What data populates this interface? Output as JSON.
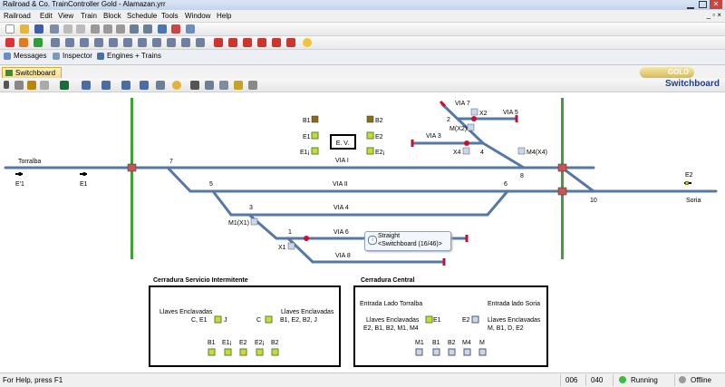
{
  "window": {
    "title": "Railroad & Co. TrainController Gold - Alamazan.yrr"
  },
  "menu": [
    "Railroad",
    "Edit",
    "View",
    "Train",
    "Block",
    "Schedule",
    "Tools",
    "Window",
    "Help"
  ],
  "panels": {
    "messages": "Messages",
    "inspector": "Inspector",
    "engines": "Engines + Trains"
  },
  "tab": {
    "label": "Switchboard"
  },
  "brand": {
    "badge": "GOLD"
  },
  "view_title": "Switchboard",
  "labels": {
    "torralba": "Torralba",
    "soria": "Soria",
    "via1": "VIA I",
    "via2": "VIA II",
    "via3": "VIA 3",
    "via4": "VIA 4",
    "via5": "VIA 5",
    "via6": "VIA 6",
    "via7": "VIA 7",
    "via8": "VIA 8",
    "ev": "E. V.",
    "b1": "B1",
    "b2": "B2",
    "e1": "E1",
    "e2": "E2",
    "e1j": "E1¡",
    "e2j": "E2¡",
    "e1_left": "E'1",
    "e1_left2": "E1",
    "e2_right": "E2",
    "n7": "7",
    "n5": "5",
    "n3": "3",
    "n1": "1",
    "n6": "6",
    "n10": "10",
    "n8": "8",
    "n2": "2",
    "n4": "4",
    "x2": "X2",
    "mx2": "M(X2)",
    "x4": "X4",
    "m4x4": "M4(X4)",
    "m1x1": "M1(X1)",
    "x1": "X1"
  },
  "tooltip": {
    "line1": "Straight",
    "line2": "<Switchboard (16/46)>"
  },
  "box1": {
    "title": "Cerradura Servicio Intermitente",
    "llaves1": "Llaves Enclavadas",
    "llaves1_val": "C, E1",
    "j": "J",
    "c": "C",
    "llaves2": "Llaves Enclavadas",
    "llaves2_val": "B1, E2, B2, J",
    "bottom": [
      "B1",
      "E1¡",
      "E2",
      "E2¡",
      "B2"
    ]
  },
  "box2": {
    "title": "Cerradura Central",
    "entrada1": "Entrada Lado Torralba",
    "entrada2": "Entrada lado Soria",
    "llaves1": "Llaves Enclavadas",
    "llaves1_val": "E2, B1, B2, M1, M4",
    "e1": "E1",
    "e2": "E2",
    "llaves2": "Llaves Enclavadas",
    "llaves2_val": "M, B1, D, E2",
    "bottom": [
      "M1",
      "B1",
      "B2",
      "M4",
      "M"
    ]
  },
  "status": {
    "help": "For Help, press F1",
    "c1": "006",
    "c2": "040",
    "running": "Running",
    "offline": "Offline"
  },
  "colors": {
    "track": "#5578a8",
    "green_bar": "#3aa332",
    "signal_red": "#c8102e"
  }
}
